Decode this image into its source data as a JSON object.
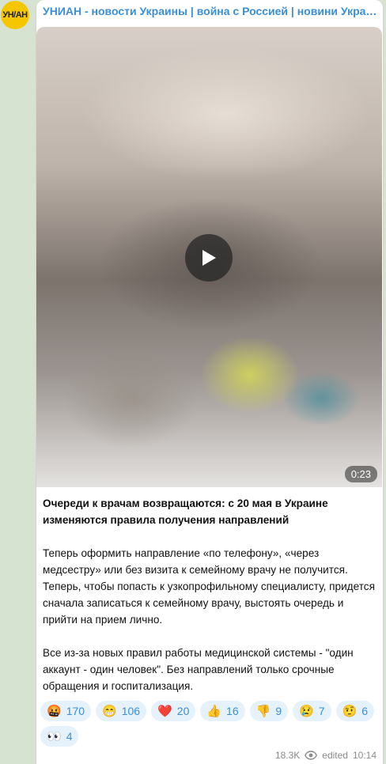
{
  "channel": {
    "avatar_text": "УН/АН",
    "name": "УНИАН - новости Украины | война с Россией | новини України | в..."
  },
  "video": {
    "duration": "0:23"
  },
  "post": {
    "headline": "Очереди к врачам возвращаются: с 20 мая в Украине изменяются правила получения направлений",
    "paragraph1": "Теперь оформить направление «по телефону», «через медсестру» или без визита к семейному врачу не получится. Теперь, чтобы попасть к узкопрофильному специалисту, придется сначала записаться к семейному врачу, выстоять очередь и прийти на прием лично.",
    "paragraph2": "Все из-за новых правил работы медицинской системы - \"один аккаунт - один человек\". Без направлений только срочные обращения и госпитализация."
  },
  "reactions": [
    {
      "emoji": "🤬",
      "count": "170"
    },
    {
      "emoji": "😁",
      "count": "106"
    },
    {
      "emoji": "❤️",
      "count": "20"
    },
    {
      "emoji": "👍",
      "count": "16"
    },
    {
      "emoji": "👎",
      "count": "9"
    },
    {
      "emoji": "😢",
      "count": "7"
    },
    {
      "emoji": "🤨",
      "count": "6"
    },
    {
      "emoji": "👀",
      "count": "4"
    }
  ],
  "footer": {
    "views": "18.3K",
    "edited_label": "edited",
    "time": "10:14"
  },
  "colors": {
    "accent": "#3a8fd6",
    "reaction_bg": "#e5f1fb",
    "avatar_bg": "#f6c700",
    "chat_bg": "#d5e3d0"
  }
}
